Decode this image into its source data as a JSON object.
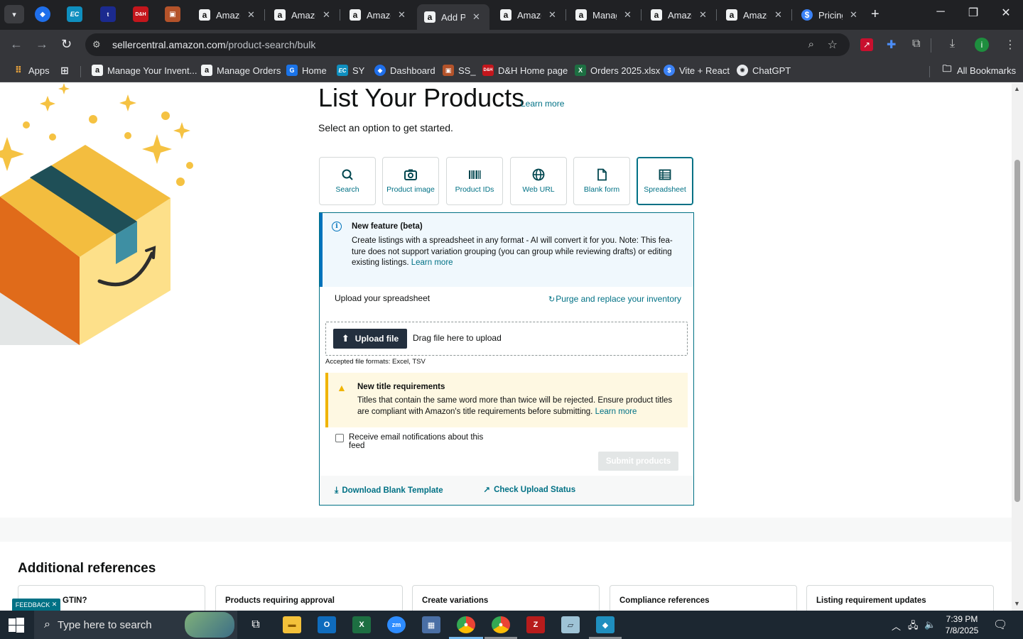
{
  "browser": {
    "tabs": [
      {
        "title": "Amazon",
        "icon": "a"
      },
      {
        "title": "Amazon",
        "icon": "a"
      },
      {
        "title": "Amazon",
        "icon": "a"
      },
      {
        "title": "Add Products",
        "icon": "a",
        "active": true
      },
      {
        "title": "Amazon",
        "icon": "a"
      },
      {
        "title": "Manage",
        "icon": "a"
      },
      {
        "title": "Amazon",
        "icon": "a"
      },
      {
        "title": "Amazon",
        "icon": "a"
      },
      {
        "title": "Pricing",
        "icon": "$"
      }
    ],
    "url_domain": "sellercentral.amazon.com",
    "url_path": "/product-search/bulk",
    "bookmarks": [
      {
        "label": "Apps"
      },
      {
        "label": "Manage Your Invent..."
      },
      {
        "label": "Manage Orders"
      },
      {
        "label": "Home"
      },
      {
        "label": "SY"
      },
      {
        "label": "Dashboard"
      },
      {
        "label": "SS_"
      },
      {
        "label": "D&H Home page"
      },
      {
        "label": "Orders 2025.xlsx"
      },
      {
        "label": "Vite + React"
      },
      {
        "label": "ChatGPT"
      },
      {
        "label": "All Bookmarks"
      }
    ],
    "profile_initial": "i"
  },
  "page": {
    "title": "List Your Products",
    "title_learn_more": "Learn more",
    "subtitle": "Select an option to get started.",
    "options": [
      {
        "label": "Search",
        "icon": "search-icon"
      },
      {
        "label": "Product image",
        "icon": "camera-icon"
      },
      {
        "label": "Product IDs",
        "icon": "barcode-icon"
      },
      {
        "label": "Web URL",
        "icon": "globe-icon"
      },
      {
        "label": "Blank form",
        "icon": "document-icon"
      },
      {
        "label": "Spreadsheet",
        "icon": "spreadsheet-icon",
        "selected": true
      }
    ],
    "info": {
      "title": "New feature (beta)",
      "text_line1": "Create listings with a spreadsheet in any format - AI will convert it for you. Note: This fea-",
      "text_line2": "ture does not support variation grouping (you can group while reviewing drafts) or editing",
      "text_line3": "existing listings.",
      "learn_more": "Learn more"
    },
    "upload_label": "Upload your spreadsheet",
    "purge_link": "Purge and replace your inventory",
    "upload_button": "Upload file",
    "drag_text": "Drag file here to upload",
    "formats": "Accepted file formats: Excel, TSV",
    "warning": {
      "title": "New title requirements",
      "text_line1": "Titles that contain the same word more than twice will be rejected. Ensure product titles",
      "text_line2": "are compliant with Amazon's title requirements before submitting.",
      "learn_more": "Learn more"
    },
    "notify_label": "Receive email notifications about this feed",
    "submit_button": "Submit products",
    "download_link": "Download Blank Template",
    "status_link": "Check Upload Status",
    "additional_title": "Additional references",
    "reference_cards": [
      "GTIN?",
      "Products requiring approval",
      "Create variations",
      "Compliance references",
      "Listing requirement updates"
    ],
    "feedback": "FEEDBACK"
  },
  "taskbar": {
    "search_placeholder": "Type here to search",
    "time": "7:39 PM",
    "date": "7/8/2025"
  },
  "colors": {
    "link": "#007185",
    "info_accent": "#0073bb",
    "warning_accent": "#f0b400",
    "upload_button": "#232f3e"
  }
}
